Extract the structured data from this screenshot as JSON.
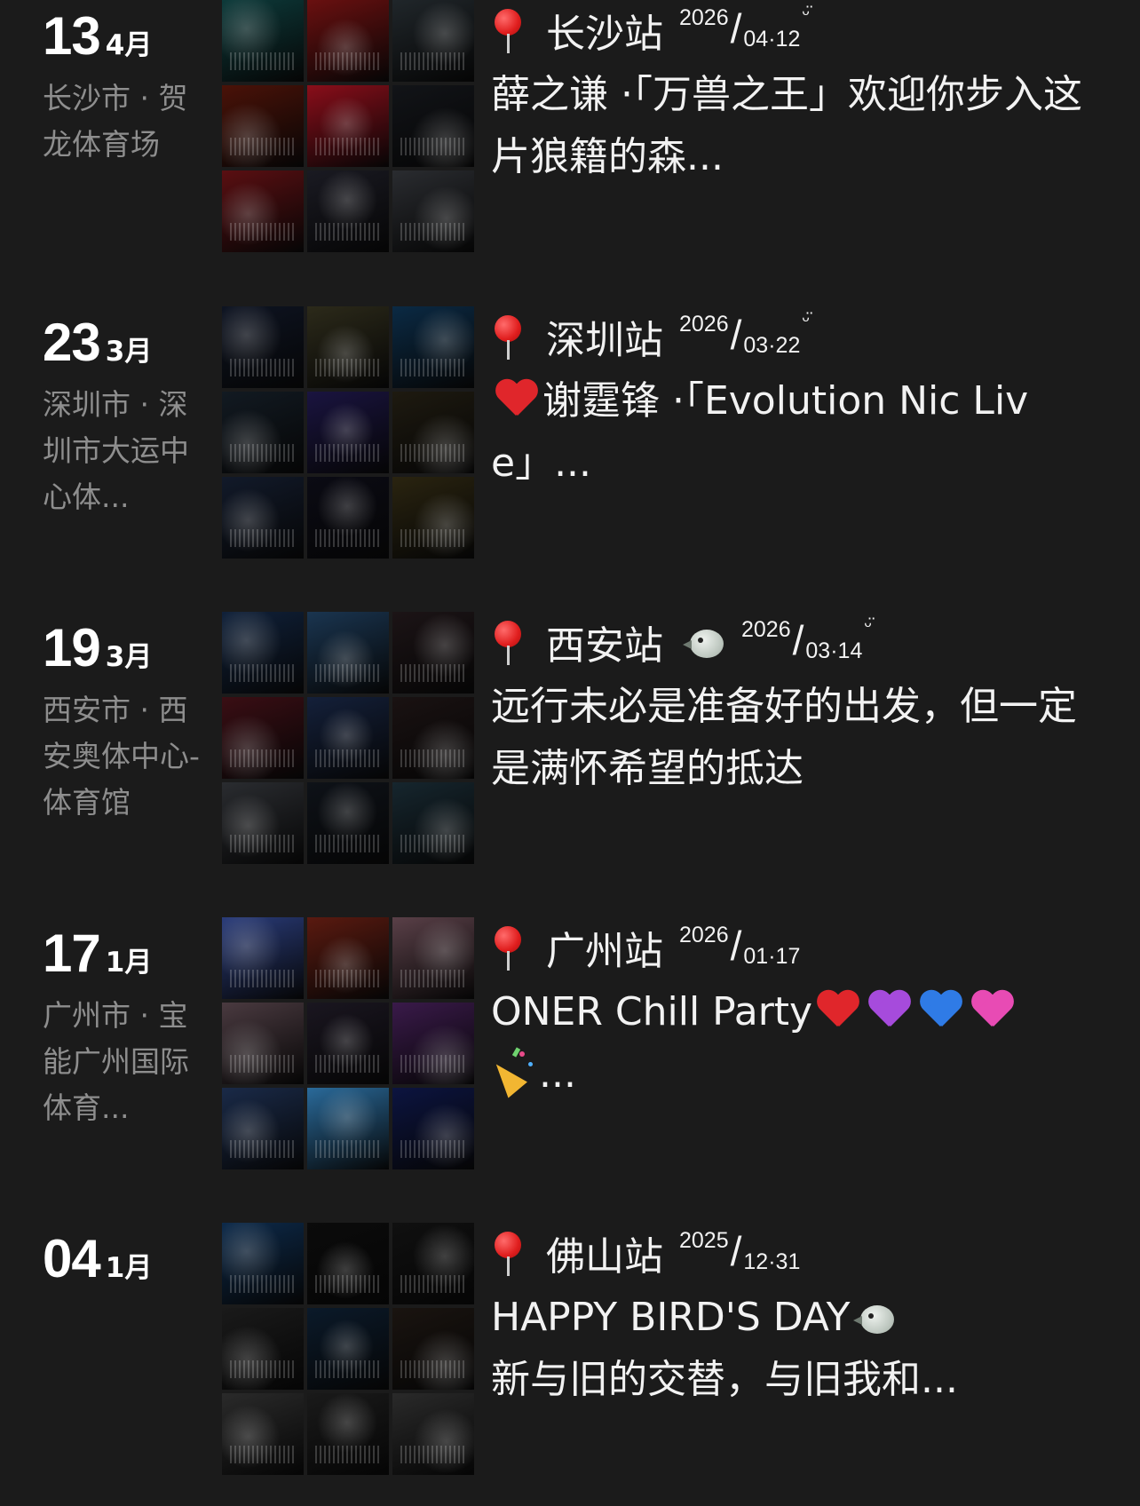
{
  "posts": [
    {
      "day": "13",
      "month": "4月",
      "location": "长沙市 · 贺龙体育场",
      "city": "长沙站",
      "bird": false,
      "stamp": {
        "year": "2026",
        "md": "04·12",
        "smile": "ᵕ̈"
      },
      "body": "薛之谦 ·「万兽之王」欢迎你步入这片狼籍的森..."
    },
    {
      "day": "23",
      "month": "3月",
      "location": "深圳市 · 深圳市大运中心体...",
      "city": "深圳站",
      "bird": false,
      "stamp": {
        "year": "2026",
        "md": "03·22",
        "smile": "ᵕ̈"
      },
      "body_prefix_heart": "#e0262b",
      "body": "谢霆锋 ·「Evolution Nic Live」..."
    },
    {
      "day": "19",
      "month": "3月",
      "location": "西安市 · 西安奥体中心-体育馆",
      "city": "西安站",
      "bird": true,
      "stamp": {
        "year": "2026",
        "md": "03·14",
        "smile": "ᵕ̈"
      },
      "body": "远行未必是准备好的出发，但一定是满怀希望的抵达"
    },
    {
      "day": "17",
      "month": "1月",
      "location": "广州市 · 宝能广州国际体育...",
      "city": "广州站",
      "bird": false,
      "stamp": {
        "year": "2026",
        "md": "01·17",
        "smile": ""
      },
      "body": "ONER Chill Party",
      "hearts": [
        "#e0262b",
        "#a64bdc",
        "#2f7be6",
        "#e84bb4"
      ],
      "body_tail": "..."
    },
    {
      "day": "04",
      "month": "1月",
      "location": "",
      "city": "佛山站",
      "bird": false,
      "stamp": {
        "year": "2025",
        "md": "12·31",
        "smile": ""
      },
      "body": "HAPPY BIRD'S DAY",
      "body_bird": true,
      "body_line2": "新与旧的交替，与旧我和..."
    }
  ],
  "colors": {
    "background": "#1b1b1b",
    "text": "#f2f2f2",
    "muted": "#8e8e8e",
    "pin": "#e01e1e"
  },
  "icons": [
    "pin-icon",
    "bird-icon",
    "heart-icon",
    "party-popper-icon",
    "smile-icon"
  ]
}
